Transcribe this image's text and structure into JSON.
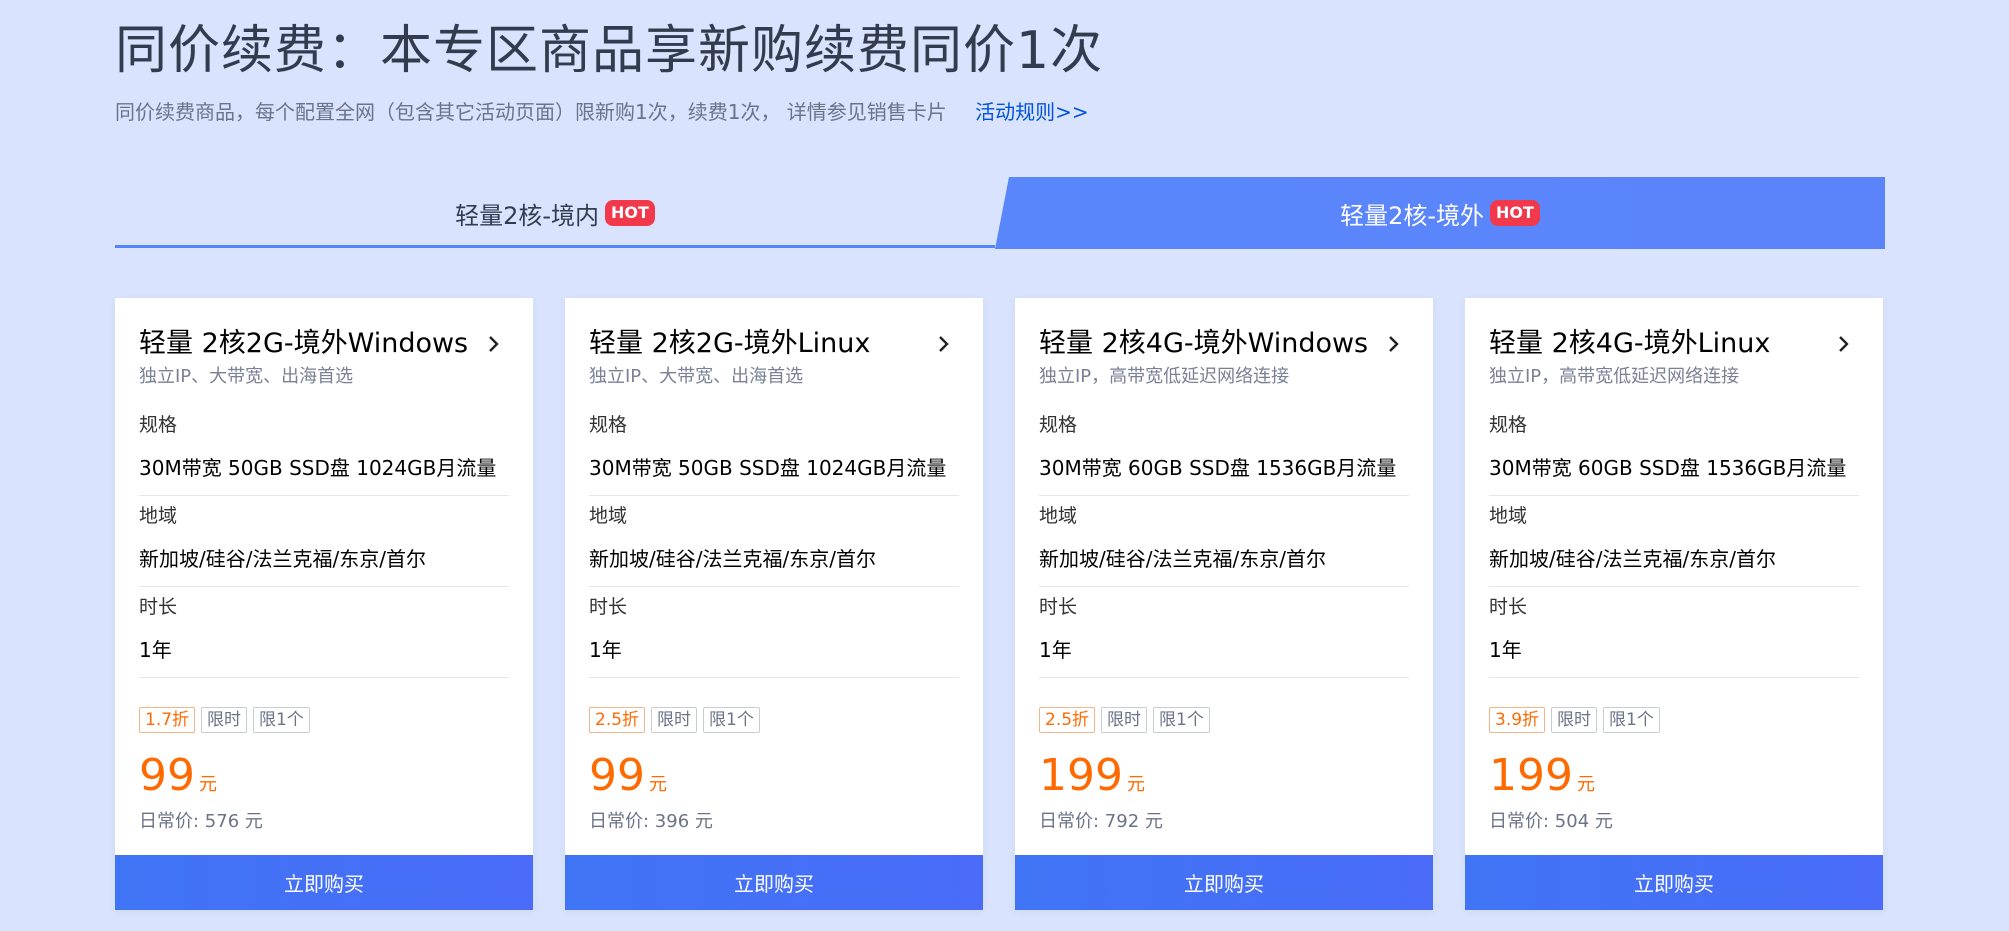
{
  "header": {
    "title": "同价续费：本专区商品享新购续费同价1次",
    "subtitle": "同价续费商品，每个配置全网（包含其它活动页面）限新购1次，续费1次， 详情参见销售卡片",
    "rules_link": "活动规则>>"
  },
  "tabs": [
    {
      "label": "轻量2核-境内",
      "badge": "HOT",
      "active": false
    },
    {
      "label": "轻量2核-境外",
      "badge": "HOT",
      "active": true
    }
  ],
  "labels": {
    "spec": "规格",
    "region": "地域",
    "duration": "时长",
    "original_prefix": "日常价: ",
    "buy": "立即购买"
  },
  "cards": [
    {
      "title": "轻量 2核2G-境外Windows",
      "desc": "独立IP、大带宽、出海首选",
      "spec": "30M带宽 50GB SSD盘 1024GB月流量",
      "region": "新加坡/硅谷/法兰克福/东京/首尔",
      "duration": "1年",
      "tags": [
        "1.7折",
        "限时",
        "限1个"
      ],
      "price": "99",
      "price_unit": "元",
      "original": "日常价: 576 元",
      "buy": "立即购买"
    },
    {
      "title": "轻量 2核2G-境外Linux",
      "desc": "独立IP、大带宽、出海首选",
      "spec": "30M带宽 50GB SSD盘 1024GB月流量",
      "region": "新加坡/硅谷/法兰克福/东京/首尔",
      "duration": "1年",
      "tags": [
        "2.5折",
        "限时",
        "限1个"
      ],
      "price": "99",
      "price_unit": "元",
      "original": "日常价: 396 元",
      "buy": "立即购买"
    },
    {
      "title": "轻量 2核4G-境外Windows",
      "desc": "独立IP，高带宽低延迟网络连接",
      "spec": "30M带宽 60GB SSD盘 1536GB月流量",
      "region": "新加坡/硅谷/法兰克福/东京/首尔",
      "duration": "1年",
      "tags": [
        "2.5折",
        "限时",
        "限1个"
      ],
      "price": "199",
      "price_unit": "元",
      "original": "日常价: 792 元",
      "buy": "立即购买"
    },
    {
      "title": "轻量 2核4G-境外Linux",
      "desc": "独立IP，高带宽低延迟网络连接",
      "spec": "30M带宽 60GB SSD盘 1536GB月流量",
      "region": "新加坡/硅谷/法兰克福/东京/首尔",
      "duration": "1年",
      "tags": [
        "3.9折",
        "限时",
        "限1个"
      ],
      "price": "199",
      "price_unit": "元",
      "original": "日常价: 504 元",
      "buy": "立即购买"
    }
  ],
  "colors": {
    "background": "#d9e3fd",
    "accent": "#4a72f7",
    "price": "#ff6a00",
    "hot": "#f2394b"
  },
  "icons": {
    "card_arrow": "chevron-right-icon"
  }
}
